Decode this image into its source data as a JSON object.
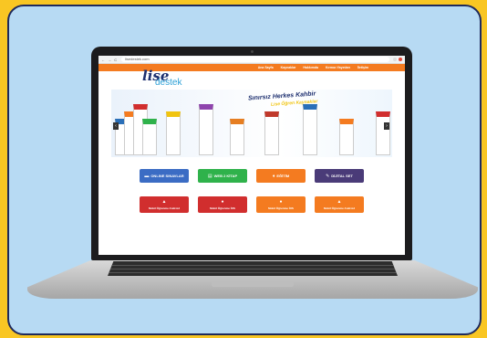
{
  "browser": {
    "url": "lisedestek.com",
    "nav_symbols": "← → C"
  },
  "site": {
    "logo_top": "lise",
    "logo_bottom": "destek",
    "menu": [
      "Ana Sayfa",
      "Kaynaklar",
      "Hakkımda",
      "Kırmızı Yayınları",
      "İletişim"
    ]
  },
  "banner": {
    "title": "Sınırsız Herkes Kahbir",
    "subtitle": "Lise Öğren Kaynaklar",
    "left_arrow": "‹",
    "right_arrow": "›"
  },
  "buttons_row1": [
    {
      "label": "ONLINE SINAVLAR",
      "icon": "▬",
      "color": "#3b6cc4"
    },
    {
      "label": "WEB 2 KİTAP",
      "icon": "▤",
      "color": "#2fb24b"
    },
    {
      "label": "EĞİTİM",
      "icon": "♦",
      "color": "#f47b20"
    },
    {
      "label": "DİJİTAL SET",
      "icon": "✎",
      "color": "#4a3b78"
    }
  ],
  "buttons_row2": [
    {
      "label": "Mobil Öğrenme Android",
      "icon": "▲",
      "color": "#d12e2e"
    },
    {
      "label": "Mobil Öğrenme İOS",
      "icon": "●",
      "color": "#d12e2e"
    },
    {
      "label": "Mobil Öğrenme İOS",
      "icon": "●",
      "color": "#f47b20"
    },
    {
      "label": "Mobil Öğrenme Android",
      "icon": "▲",
      "color": "#f47b20"
    }
  ],
  "colors": {
    "accent_orange": "#f47b20",
    "background_yellow": "#f9c623",
    "card_blue": "#b7daf3"
  }
}
